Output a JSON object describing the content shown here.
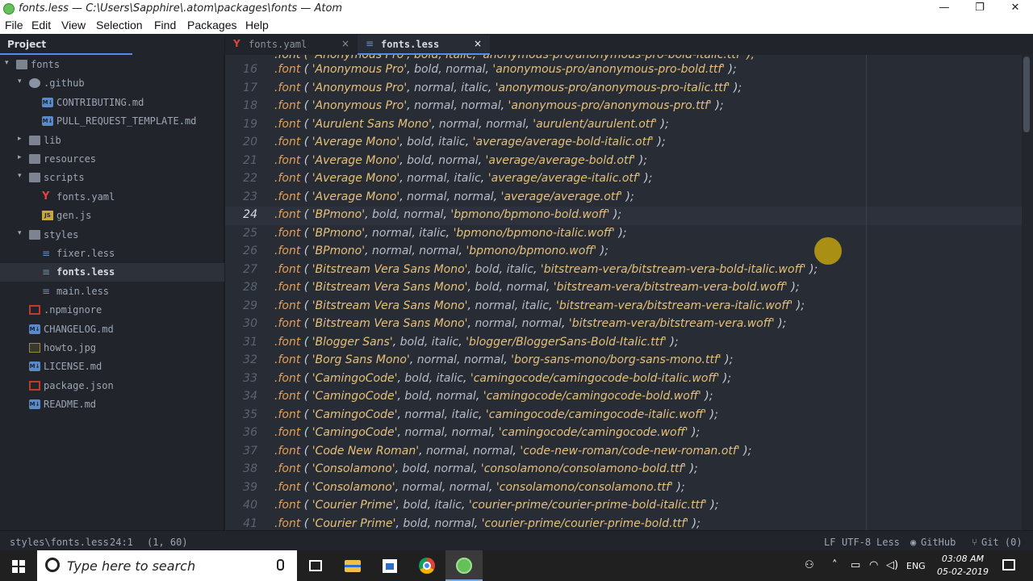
{
  "window": {
    "title": "fonts.less — C:\\Users\\Sapphire\\.atom\\packages\\fonts — Atom",
    "minimize": "—",
    "maximize": "❐",
    "close": "✕"
  },
  "menu": [
    "File",
    "Edit",
    "View",
    "Selection",
    "Find",
    "Packages",
    "Help"
  ],
  "tree": {
    "header": "Project",
    "rows": [
      {
        "name": "fonts",
        "icon": "folder",
        "arrow": "▾"
      },
      {
        "name": ".github",
        "icon": "github",
        "arrow": "▾"
      },
      {
        "name": "CONTRIBUTING.md",
        "icon": "md"
      },
      {
        "name": "PULL_REQUEST_TEMPLATE.md",
        "icon": "md"
      },
      {
        "name": "lib",
        "icon": "folder",
        "arrow": "▸"
      },
      {
        "name": "resources",
        "icon": "folder",
        "arrow": "▸"
      },
      {
        "name": "scripts",
        "icon": "folder",
        "arrow": "▾"
      },
      {
        "name": "fonts.yaml",
        "icon": "yaml"
      },
      {
        "name": "gen.js",
        "icon": "js"
      },
      {
        "name": "styles",
        "icon": "folder",
        "arrow": "▾"
      },
      {
        "name": "fixer.less",
        "icon": "less"
      },
      {
        "name": "fonts.less",
        "icon": "less",
        "selected": true
      },
      {
        "name": "main.less",
        "icon": "less"
      },
      {
        "name": ".npmignore",
        "icon": "npm"
      },
      {
        "name": "CHANGELOG.md",
        "icon": "md"
      },
      {
        "name": "howto.jpg",
        "icon": "img"
      },
      {
        "name": "LICENSE.md",
        "icon": "md"
      },
      {
        "name": "package.json",
        "icon": "json"
      },
      {
        "name": "README.md",
        "icon": "md"
      }
    ]
  },
  "tabs": [
    {
      "label": "fonts.yaml",
      "icon": "Y",
      "close": "×",
      "active": false
    },
    {
      "label": "fonts.less",
      "icon": "≡",
      "close": "×",
      "active": true
    }
  ],
  "editor": {
    "top_partial": ".font ( 'Anonymous Pro', bold, italic, 'anonymous-pro/anonymous-pro-bold-italic.ttf' );",
    "cursor_line": 24,
    "lines": [
      {
        "n": "16",
        "name": "Anonymous Pro",
        "args": "bold, normal",
        "path": "anonymous-pro/anonymous-pro-bold.ttf"
      },
      {
        "n": "17",
        "name": "Anonymous Pro",
        "args": "normal, italic",
        "path": "anonymous-pro/anonymous-pro-italic.ttf"
      },
      {
        "n": "18",
        "name": "Anonymous Pro",
        "args": "normal, normal",
        "path": "anonymous-pro/anonymous-pro.ttf"
      },
      {
        "n": "19",
        "name": "Aurulent Sans Mono",
        "args": "normal, normal",
        "path": "aurulent/aurulent.otf"
      },
      {
        "n": "20",
        "name": "Average Mono",
        "args": "bold, italic",
        "path": "average/average-bold-italic.otf"
      },
      {
        "n": "21",
        "name": "Average Mono",
        "args": "bold, normal",
        "path": "average/average-bold.otf"
      },
      {
        "n": "22",
        "name": "Average Mono",
        "args": "normal, italic",
        "path": "average/average-italic.otf"
      },
      {
        "n": "23",
        "name": "Average Mono",
        "args": "normal, normal",
        "path": "average/average.otf"
      },
      {
        "n": "24",
        "name": "BPmono",
        "args": "bold, normal",
        "path": "bpmono/bpmono-bold.woff"
      },
      {
        "n": "25",
        "name": "BPmono",
        "args": "normal, italic",
        "path": "bpmono/bpmono-italic.woff"
      },
      {
        "n": "26",
        "name": "BPmono",
        "args": "normal, normal",
        "path": "bpmono/bpmono.woff"
      },
      {
        "n": "27",
        "name": "Bitstream Vera Sans Mono",
        "args": "bold, italic",
        "path": "bitstream-vera/bitstream-vera-bold-italic.woff"
      },
      {
        "n": "28",
        "name": "Bitstream Vera Sans Mono",
        "args": "bold, normal",
        "path": "bitstream-vera/bitstream-vera-bold.woff"
      },
      {
        "n": "29",
        "name": "Bitstream Vera Sans Mono",
        "args": "normal, italic",
        "path": "bitstream-vera/bitstream-vera-italic.woff"
      },
      {
        "n": "30",
        "name": "Bitstream Vera Sans Mono",
        "args": "normal, normal",
        "path": "bitstream-vera/bitstream-vera.woff"
      },
      {
        "n": "31",
        "name": "Blogger Sans",
        "args": "bold, italic",
        "path": "blogger/BloggerSans-Bold-Italic.ttf"
      },
      {
        "n": "32",
        "name": "Borg Sans Mono",
        "args": "normal, normal",
        "path": "borg-sans-mono/borg-sans-mono.ttf"
      },
      {
        "n": "33",
        "name": "CamingoCode",
        "args": "bold, italic",
        "path": "camingocode/camingocode-bold-italic.woff"
      },
      {
        "n": "34",
        "name": "CamingoCode",
        "args": "bold, normal",
        "path": "camingocode/camingocode-bold.woff"
      },
      {
        "n": "35",
        "name": "CamingoCode",
        "args": "normal, italic",
        "path": "camingocode/camingocode-italic.woff"
      },
      {
        "n": "36",
        "name": "CamingoCode",
        "args": "normal, normal",
        "path": "camingocode/camingocode.woff"
      },
      {
        "n": "37",
        "name": "Code New Roman",
        "args": "normal, normal",
        "path": "code-new-roman/code-new-roman.otf"
      },
      {
        "n": "38",
        "name": "Consolamono",
        "args": "bold, normal",
        "path": "consolamono/consolamono-bold.ttf"
      },
      {
        "n": "39",
        "name": "Consolamono",
        "args": "normal, normal",
        "path": "consolamono/consolamono.ttf"
      },
      {
        "n": "40",
        "name": "Courier Prime",
        "args": "bold, italic",
        "path": "courier-prime/courier-prime-bold-italic.ttf"
      },
      {
        "n": "41",
        "name": "Courier Prime",
        "args": "bold, normal",
        "path": "courier-prime/courier-prime-bold.ttf"
      }
    ]
  },
  "status": {
    "path": "styles\\fonts.less",
    "position": "24:1",
    "selection": "(1, 60)",
    "line_ending": "LF",
    "encoding": "UTF-8",
    "grammar": "Less",
    "github": "GitHub",
    "git": "Git (0)"
  },
  "taskbar": {
    "search_placeholder": "Type here to search",
    "lang": "ENG",
    "time": "03:08 AM",
    "date": "05-02-2019"
  },
  "colors": {
    "accent": "#568af2",
    "function": "#e5a05b",
    "string": "#e5c07b"
  }
}
